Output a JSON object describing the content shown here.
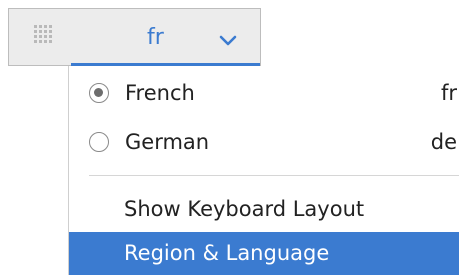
{
  "indicator": {
    "label": "fr",
    "grip_icon": "drag-grip-icon",
    "chevron_icon": "chevron-down-icon",
    "accent_color": "#3b7bd0"
  },
  "menu": {
    "layouts": [
      {
        "name": "French",
        "code": "fr",
        "selected": true
      },
      {
        "name": "German",
        "code": "de",
        "selected": false
      }
    ],
    "actions": [
      {
        "label": "Show Keyboard Layout",
        "highlighted": false
      },
      {
        "label": "Region & Language",
        "highlighted": true
      }
    ],
    "highlight_color": "#3b7bd0"
  }
}
